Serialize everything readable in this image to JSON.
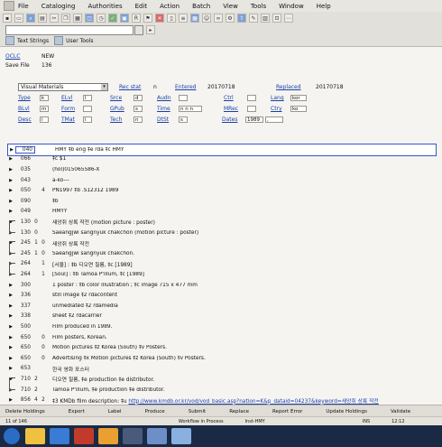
{
  "menu": [
    "File",
    "Cataloging",
    "Authorities",
    "Edit",
    "Action",
    "Batch",
    "View",
    "Tools",
    "Window",
    "Help"
  ],
  "toolbar3": {
    "text_strings": "Text Strings",
    "user_tools": "User Tools"
  },
  "header": {
    "source_label": "OCLC",
    "source_value": "NEW",
    "save_label": "Save File",
    "save_value": "136"
  },
  "fixed_field": {
    "format": "Visual Materials",
    "rec_stat_label": "Rec stat",
    "rec_stat": "n",
    "entered_label": "Entered",
    "entered": "20170718",
    "replaced_label": "Replaced",
    "replaced": "20170718",
    "type_label": "Type",
    "type": "k",
    "elvl_label": "ELvl",
    "elvl": "I",
    "srce_label": "Srce",
    "srce": "d",
    "audn_label": "Audn",
    "audn": "",
    "ctrl_label": "Ctrl",
    "ctrl": "",
    "lang_label": "Lang",
    "lang": "kor",
    "blvl_label": "BLvl",
    "blvl": "m",
    "form_label": "Form",
    "form": "",
    "gpub_label": "GPub",
    "gpub": "s",
    "time_label": "Time",
    "time": "n n n",
    "mrec_label": "MRec",
    "mrec": "",
    "ctry_label": "Ctry",
    "ctry": "ko",
    "desc_label": "Desc",
    "desc": "i",
    "tmat_label": "TMat",
    "tmat": "i",
    "tech_label": "Tech",
    "tech": "n",
    "dtst_label": "DtSt",
    "dtst": "s",
    "dates_label": "Dates",
    "dates1": "1989",
    "dates2": ","
  },
  "fields": [
    {
      "tag": "040",
      "i1": "",
      "i2": "",
      "text": "HMY ‡b eng ‡e rda ‡c HMY"
    },
    {
      "tag": "066",
      "i1": "",
      "i2": "",
      "text": "‡c $1"
    },
    {
      "tag": "035",
      "i1": "",
      "i2": "",
      "text": "(hol)015065586-X"
    },
    {
      "tag": "043",
      "i1": "",
      "i2": "",
      "text": "a-ko---"
    },
    {
      "tag": "050",
      "i1": "",
      "i2": "4",
      "text": "PN1997 ‡b .S12312 1989"
    },
    {
      "tag": "090",
      "i1": "",
      "i2": "",
      "text": "‡b"
    },
    {
      "tag": "049",
      "i1": "",
      "i2": "",
      "text": "HMYY"
    },
    {
      "tag": "130",
      "i1": "0",
      "i2": "",
      "text": "새앙쥐 상록 작전 (motion picture : poster)"
    },
    {
      "tag": "130",
      "i1": "0",
      "i2": "",
      "text": "Saeangjwi sangnyuk chakchŏn (motion picture : poster)"
    },
    {
      "tag": "245",
      "i1": "1",
      "i2": "0",
      "text": "새앙쥐 상륙 작전"
    },
    {
      "tag": "245",
      "i1": "1",
      "i2": "0",
      "text": "Saeangjwi sangnyuk chakchŏn."
    },
    {
      "tag": "264",
      "i1": "",
      "i2": "1",
      "text": "[서울] : ‡b 디오연 필름, ‡c [1989]"
    },
    {
      "tag": "264",
      "i1": "",
      "i2": "1",
      "text": "[Sŏul] : ‡b Tamoa P'illŭm, ‡c [1989]"
    },
    {
      "tag": "300",
      "i1": "",
      "i2": "",
      "text": "1 poster : ‡b color illustration ; ‡c image 715 x 477 mm"
    },
    {
      "tag": "336",
      "i1": "",
      "i2": "",
      "text": "still image ‡2 rdacontent"
    },
    {
      "tag": "337",
      "i1": "",
      "i2": "",
      "text": "unmediated ‡2 rdamedia"
    },
    {
      "tag": "338",
      "i1": "",
      "i2": "",
      "text": "sheet ‡2 rdacarrier"
    },
    {
      "tag": "500",
      "i1": "",
      "i2": "",
      "text": "Film produced in 1989."
    },
    {
      "tag": "650",
      "i1": "",
      "i2": "0",
      "text": "Film posters, Korean."
    },
    {
      "tag": "650",
      "i1": "",
      "i2": "0",
      "text": "Motion pictures ‡z Korea (South) ‡v Posters."
    },
    {
      "tag": "650",
      "i1": "",
      "i2": "0",
      "text": "Advertising ‡x Motion pictures ‡z Korea (South) ‡v Posters."
    },
    {
      "tag": "653",
      "i1": "",
      "i2": "",
      "text": "한국 영화 포스터"
    },
    {
      "tag": "710",
      "i1": "2",
      "i2": "",
      "text": "디오연 필름, ‡e production ‡e distributor."
    },
    {
      "tag": "710",
      "i1": "2",
      "i2": "",
      "text": "Tamoa P'illŭm, ‡e production ‡e distributor."
    },
    {
      "tag": "856",
      "i1": "4",
      "i2": "2",
      "text_prefix": "‡3 KMDb film description: ‡u ",
      "link": "http://www.kmdb.or.kr/vod/vod_basic.asp?nation=K&p_dataid=04237&keyword=새앙쥐 상륙 작전"
    }
  ],
  "status_buttons": [
    "Delete Holdings",
    "Export",
    "Label",
    "Produce",
    "Submit",
    "Replace",
    "Report Error",
    "Update Holdings",
    "Validate"
  ],
  "status_bar": {
    "pos": "11 of 146",
    "workflow": "Workflow in Process",
    "inst": "Inst-HMY",
    "ins": "INS",
    "time": "12:12"
  }
}
